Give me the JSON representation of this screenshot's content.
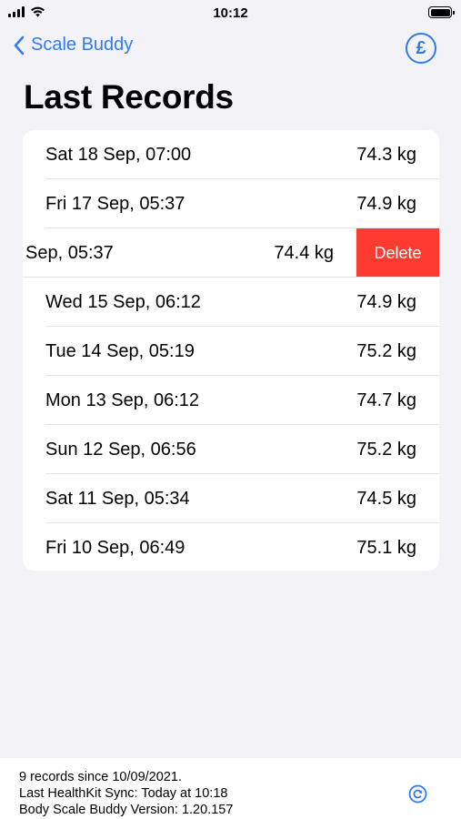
{
  "status_bar": {
    "time": "10:12"
  },
  "nav": {
    "back_label": "Scale Buddy",
    "currency_symbol": "£"
  },
  "title": "Last Records",
  "records": [
    {
      "date": "Sat 18 Sep, 07:00",
      "weight": "74.3 kg"
    },
    {
      "date": "Fri 17 Sep, 05:37",
      "weight": "74.9 kg"
    },
    {
      "date": "Sep, 05:37",
      "weight": "74.4 kg"
    },
    {
      "date": "Wed 15 Sep, 06:12",
      "weight": "74.9 kg"
    },
    {
      "date": "Tue 14 Sep, 05:19",
      "weight": "75.2 kg"
    },
    {
      "date": "Mon 13 Sep, 06:12",
      "weight": "74.7 kg"
    },
    {
      "date": "Sun 12 Sep, 06:56",
      "weight": "75.2 kg"
    },
    {
      "date": "Sat 11 Sep, 05:34",
      "weight": "74.5 kg"
    },
    {
      "date": "Fri 10 Sep, 06:49",
      "weight": "75.1 kg"
    }
  ],
  "delete_label": "Delete",
  "footer": {
    "line1": "9 records since 10/09/2021.",
    "line2": "Last HealthKit Sync: Today at 10:18",
    "line3": "Body Scale Buddy Version: 1.20.157"
  },
  "colors": {
    "accent": "#2f7bf5",
    "destructive": "#ff3b30",
    "background": "#f2f2f7"
  },
  "icons": [
    "signal-icon",
    "wifi-icon",
    "battery-icon",
    "chevron-left-icon",
    "pound-icon",
    "sync-icon"
  ]
}
